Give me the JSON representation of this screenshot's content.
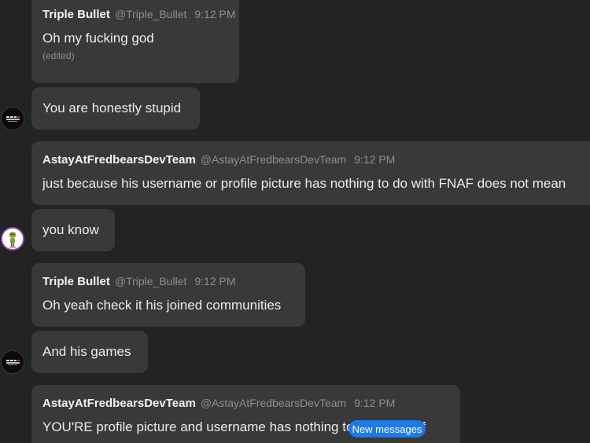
{
  "messages": [
    {
      "author": "Triple Bullet",
      "handle": "@Triple_Bullet",
      "time": "9:12 PM",
      "text": "Oh my fucking god",
      "edited": "(edited)"
    },
    {
      "text": "You are honestly stupid"
    },
    {
      "author": "AstayAtFredbearsDevTeam",
      "handle": "@AstayAtFredbearsDevTeam",
      "time": "9:12 PM",
      "text": "just because his username or profile picture has nothing to do with FNAF does not mean"
    },
    {
      "text": "you know"
    },
    {
      "author": "Triple Bullet",
      "handle": "@Triple_Bullet",
      "time": "9:12 PM",
      "text": "Oh yeah check it his joined communities"
    },
    {
      "text": "And his games"
    },
    {
      "author": "AstayAtFredbearsDevTeam",
      "handle": "@AstayAtFredbearsDevTeam",
      "time": "9:12 PM",
      "text": "YOU'RE profile picture and username has nothing to do with fnaf"
    }
  ],
  "new_messages_label": "New messages",
  "colors": {
    "background": "#232323",
    "bubble": "#393939",
    "accent": "#1d7ae8",
    "muted_text": "#8e8e8e"
  },
  "icons": {
    "triple_bullet_avatar": "avatar-triple-bullet-logo",
    "astay_avatar": "avatar-animatronic-figure"
  }
}
